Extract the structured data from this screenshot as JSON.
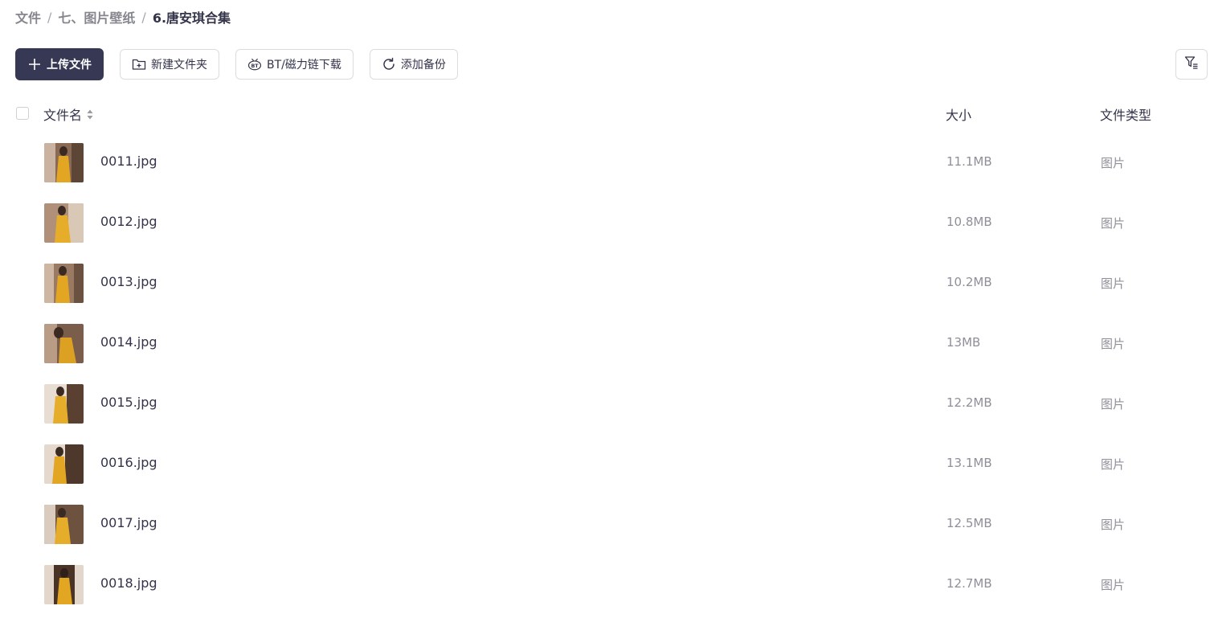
{
  "breadcrumb": {
    "items": [
      "文件",
      "七、图片壁纸",
      "6.唐安琪合集"
    ],
    "separator": "/"
  },
  "toolbar": {
    "upload_label": "上传文件",
    "new_folder_label": "新建文件夹",
    "bt_label": "BT/磁力链下载",
    "backup_label": "添加备份"
  },
  "table": {
    "headers": {
      "name": "文件名",
      "size": "大小",
      "type": "文件类型"
    },
    "rows": [
      {
        "name": "0011.jpg",
        "size": "11.1MB",
        "type": "图片"
      },
      {
        "name": "0012.jpg",
        "size": "10.8MB",
        "type": "图片"
      },
      {
        "name": "0013.jpg",
        "size": "10.2MB",
        "type": "图片"
      },
      {
        "name": "0014.jpg",
        "size": "13MB",
        "type": "图片"
      },
      {
        "name": "0015.jpg",
        "size": "12.2MB",
        "type": "图片"
      },
      {
        "name": "0016.jpg",
        "size": "13.1MB",
        "type": "图片"
      },
      {
        "name": "0017.jpg",
        "size": "12.5MB",
        "type": "图片"
      },
      {
        "name": "0018.jpg",
        "size": "12.7MB",
        "type": "图片"
      }
    ]
  },
  "icons": {
    "upload": "plus-icon",
    "new_folder": "folder-plus-icon",
    "bt": "bt-icon",
    "backup": "refresh-icon",
    "filter": "filter-icon",
    "sort": "sort-icon"
  },
  "colors": {
    "primary": "#373853",
    "text": "#33334a",
    "muted": "#8f8f99",
    "border": "#dcdce0"
  }
}
